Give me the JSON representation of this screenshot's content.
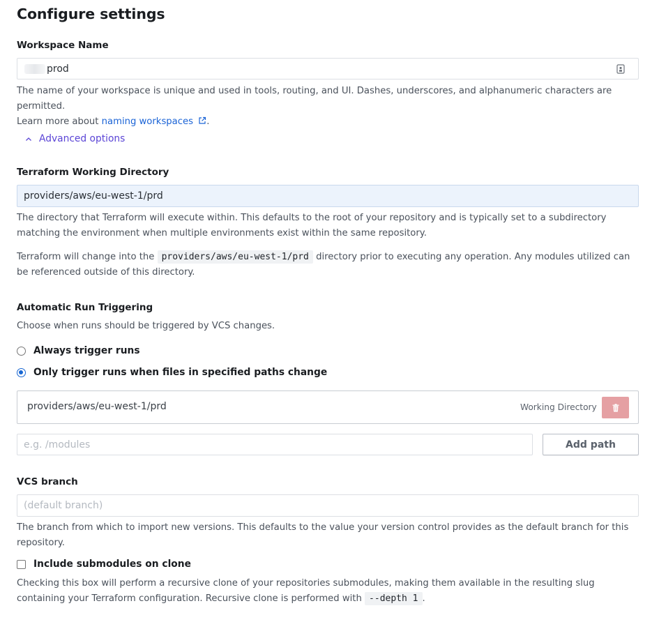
{
  "page": {
    "title": "Configure settings"
  },
  "workspace": {
    "label": "Workspace Name",
    "value": "prod",
    "help_text": "The name of your workspace is unique and used in tools, routing, and UI. Dashes, underscores, and alphanumeric characters are permitted.",
    "learn_more_prefix": "Learn more about ",
    "learn_more_link": "naming workspaces",
    "learn_more_suffix": "."
  },
  "advanced": {
    "label": "Advanced options"
  },
  "working_dir": {
    "label": "Terraform Working Directory",
    "value": "providers/aws/eu-west-1/prd",
    "help_1": "The directory that Terraform will execute within. This defaults to the root of your repository and is typically set to a subdirectory matching the environment when multiple environments exist within the same repository.",
    "help_2_prefix": "Terraform will change into the",
    "help_2_code": "providers/aws/eu-west-1/prd",
    "help_2_suffix": "directory prior to executing any operation. Any modules utilized can be referenced outside of this directory."
  },
  "triggering": {
    "label": "Automatic Run Triggering",
    "help": "Choose when runs should be triggered by VCS changes.",
    "option_always": "Always trigger runs",
    "option_paths": "Only trigger runs when files in specified paths change",
    "selected": "paths",
    "path_entry": "providers/aws/eu-west-1/prd",
    "path_tag": "Working Directory",
    "path_placeholder": "e.g. /modules",
    "add_path_label": "Add path"
  },
  "vcs": {
    "label": "VCS branch",
    "placeholder": "(default branch)",
    "help": "The branch from which to import new versions. This defaults to the value your version control provides as the default branch for this repository."
  },
  "submodules": {
    "label": "Include submodules on clone",
    "checked": false,
    "help_prefix": "Checking this box will perform a recursive clone of your repositories submodules, making them available in the resulting slug containing your Terraform configuration. Recursive clone is performed with",
    "help_code": "--depth 1",
    "help_suffix": "."
  },
  "colors": {
    "link": "#1a63d6",
    "accent": "#5b45d6",
    "danger": "#e5a0a3"
  }
}
